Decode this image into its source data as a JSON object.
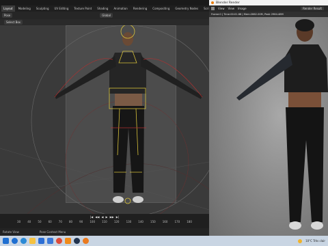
{
  "blender": {
    "workspace_tabs": [
      "Layout",
      "Modeling",
      "Sculpting",
      "UV Editing",
      "Texture Paint",
      "Shading",
      "Animation",
      "Rendering",
      "Compositing",
      "Geometry Nodes",
      "Scripting"
    ],
    "active_tab": "Layout",
    "header": {
      "mode": "Pose",
      "orientation": "Global",
      "select_box": "Select Box"
    },
    "timeline": {
      "controls": [
        "|◀",
        "◀◀",
        "◀",
        "▶",
        "▶▶",
        "▶|"
      ],
      "frames": [
        "30",
        "40",
        "50",
        "60",
        "70",
        "80",
        "90",
        "100",
        "110",
        "120",
        "130",
        "140",
        "150",
        "160",
        "170",
        "180"
      ]
    },
    "status": {
      "left": "Rotate View",
      "middle": "Pose Context Menu"
    }
  },
  "render_window": {
    "title": "Blender Render",
    "menu": [
      "View",
      "View",
      "Image"
    ],
    "slot": "Render Result",
    "info": "Frame:0 | Time:00:01.88 | Mem:2862.00M, Peak 2964.48M"
  },
  "taskbar": {
    "weather": "10°C Très clair",
    "icons": [
      "start-icon",
      "search-icon",
      "edge-icon",
      "explorer-icon",
      "mail-icon",
      "store-icon",
      "chrome-icon",
      "vlc-icon",
      "steam-icon",
      "blender-icon"
    ],
    "icon_colors": [
      "#1f6fd1",
      "#1f6fd1",
      "#2b8ad6",
      "#f5c242",
      "#2c6ed5",
      "#3b78d8",
      "#de4b3a",
      "#f08b1a",
      "#22344f",
      "#ea7a1f"
    ]
  }
}
